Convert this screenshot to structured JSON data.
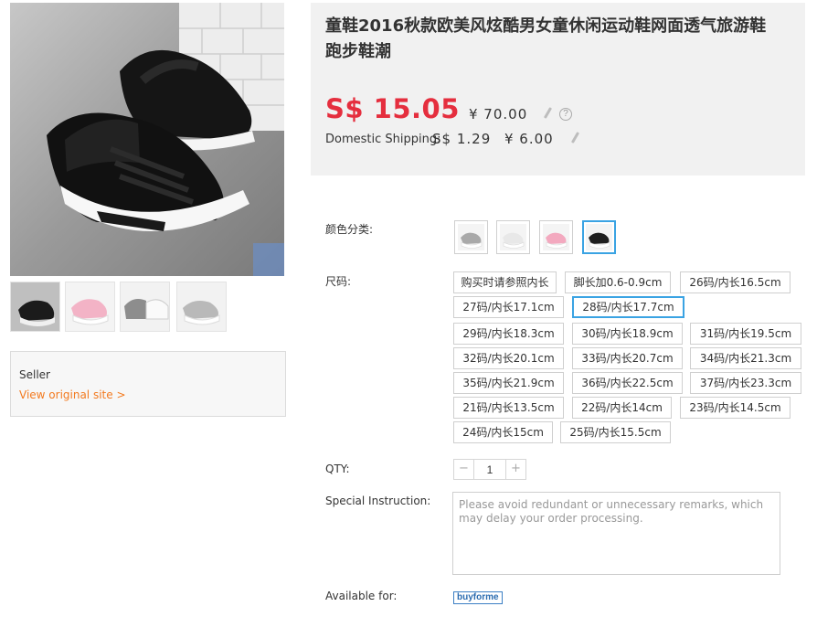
{
  "product": {
    "title": "童鞋2016秋款欧美风炫酷男女童休闲运动鞋网面透气旅游鞋跑步鞋潮",
    "price_sgd": "S$ 15.05",
    "price_rmb": "¥ 70.00",
    "help_glyph": "?"
  },
  "shipping": {
    "label": "Domestic Shipping:",
    "sgd": "S$ 1.29",
    "rmb": "¥ 6.00"
  },
  "seller": {
    "label": "Seller",
    "link": "View original site >"
  },
  "thumbnails": [
    {
      "name": "black",
      "color": "#1f1f1f"
    },
    {
      "name": "pink",
      "color": "#f2b6c6"
    },
    {
      "name": "grey-white",
      "color": "#d0d0d0"
    },
    {
      "name": "grey",
      "color": "#b8b8b8"
    }
  ],
  "options": {
    "color_label": "颜色分类:",
    "size_label": "尺码:",
    "colors": [
      {
        "name": "grey",
        "color": "#a9a9a9",
        "selected": false
      },
      {
        "name": "white",
        "color": "#e8e8e8",
        "selected": false
      },
      {
        "name": "pink",
        "color": "#f3a9bf",
        "selected": false
      },
      {
        "name": "black",
        "color": "#1f1f1f",
        "selected": true
      }
    ],
    "sizes": [
      "购买时请参照内长",
      "脚长加0.6-0.9cm",
      "26码/内长16.5cm",
      "27码/内长17.1cm",
      "28码/内长17.7cm",
      "29码/内长18.3cm",
      "30码/内长18.9cm",
      "31码/内长19.5cm",
      "32码/内长20.1cm",
      "33码/内长20.7cm",
      "34码/内长21.3cm",
      "35码/内长21.9cm",
      "36码/内长22.5cm",
      "37码/内长23.3cm",
      "21码/内长13.5cm",
      "22码/内长14cm",
      "23码/内长14.5cm",
      "24码/内长15cm",
      "25码/内长15.5cm"
    ],
    "selected_size_index": 4
  },
  "quantity": {
    "label": "QTY:",
    "minus": "−",
    "value": "1",
    "plus": "+"
  },
  "instruction": {
    "label": "Special Instruction:",
    "placeholder": "Please avoid redundant or unnecessary remarks, which may delay your order processing."
  },
  "availability": {
    "label": "Available for:",
    "badge": "buyforme"
  },
  "colors": {
    "price_red": "#e52e3e",
    "link_orange": "#f37a1f",
    "select_blue": "#3aa3e3"
  }
}
